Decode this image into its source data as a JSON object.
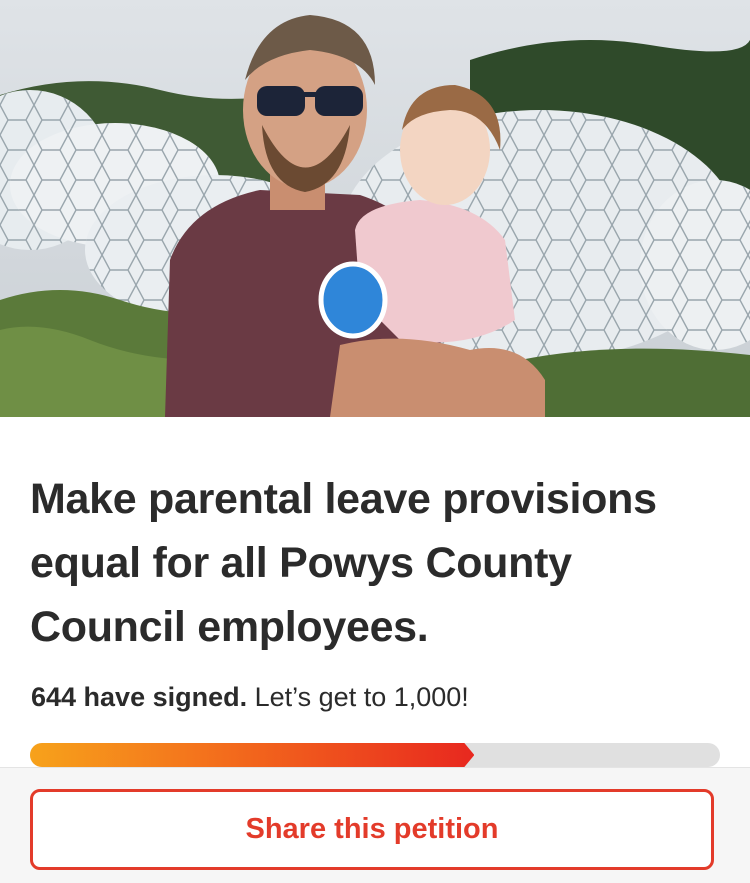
{
  "hero": {
    "image_description_name": "petition-photo"
  },
  "petition": {
    "title": "Make parental leave provisions equal for all Powys County Council employees.",
    "signed_count_text": "644 have signed.",
    "goal_text": " Let’s get to 1,000!",
    "signed": 644,
    "goal": 1000
  },
  "share_button": {
    "label": "Share this petition"
  },
  "colors": {
    "accent": "#e33b2a",
    "progress_start": "#f7a21b",
    "progress_end": "#e8281f",
    "track": "#e0e0e0"
  }
}
